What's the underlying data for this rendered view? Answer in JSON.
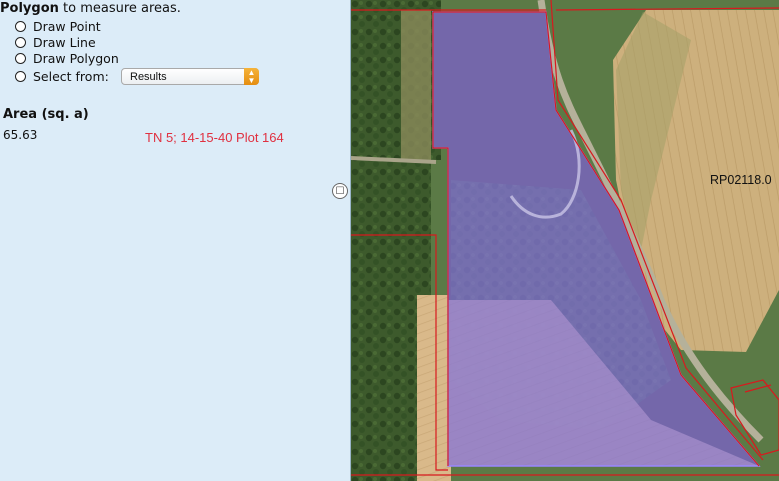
{
  "instructions": {
    "tool_bold": "Polygon",
    "tool_rest": " to measure areas."
  },
  "options": [
    {
      "label": "Draw Point"
    },
    {
      "label": "Draw Line"
    },
    {
      "label": "Draw Polygon"
    },
    {
      "label": "Select from:"
    }
  ],
  "select": {
    "value": "Results"
  },
  "area": {
    "header": "Area (sq. a)",
    "value": "65.63"
  },
  "selection_label": "TN 5; 14-15-40 Plot 164",
  "map": {
    "parcel_label": "RP02118.0"
  },
  "colors": {
    "panel_bg": "#dcecf8",
    "polygon_fill": "#8a79e0",
    "parcel_line": "#d8191e",
    "label_red": "#e03040",
    "select_arrow": "#f0a020"
  }
}
